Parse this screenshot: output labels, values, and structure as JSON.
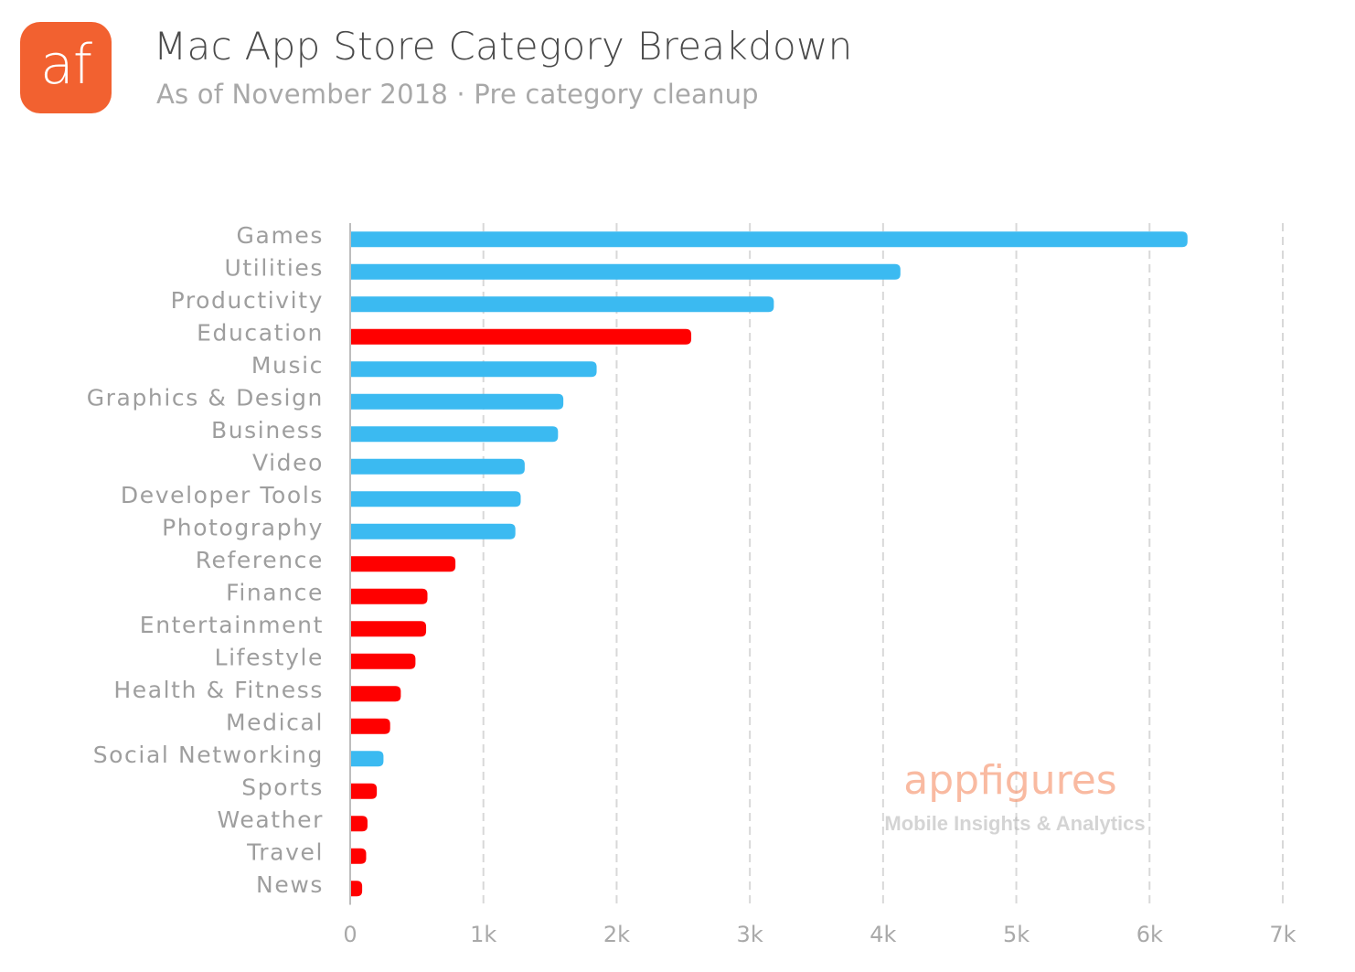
{
  "header": {
    "logo_text": "af",
    "title": "Mac App Store Category Breakdown",
    "subtitle": "As of November 2018 · Pre category cleanup"
  },
  "colors": {
    "logo": "#f26130",
    "highlight_bar": "#3bbaf1",
    "other_bar": "#ff0000",
    "watermark_brand": "#f7a07e"
  },
  "watermark": {
    "brand": "appfigures",
    "tagline": "Mobile Insights & Analytics"
  },
  "chart_data": {
    "type": "bar",
    "orientation": "horizontal",
    "title": "Mac App Store Category Breakdown",
    "subtitle": "As of November 2018 · Pre category cleanup",
    "xlabel": "",
    "ylabel": "",
    "xlim": [
      0,
      7000
    ],
    "x_ticks": [
      0,
      1000,
      2000,
      3000,
      4000,
      5000,
      6000,
      7000
    ],
    "x_tick_labels": [
      "0",
      "1k",
      "2k",
      "3k",
      "4k",
      "5k",
      "6k",
      "7k"
    ],
    "grid": "vertical dashed",
    "legend": "none",
    "categories": [
      "Games",
      "Utilities",
      "Productivity",
      "Education",
      "Music",
      "Graphics & Design",
      "Business",
      "Video",
      "Developer Tools",
      "Photography",
      "Reference",
      "Finance",
      "Entertainment",
      "Lifestyle",
      "Health & Fitness",
      "Medical",
      "Social Networking",
      "Sports",
      "Weather",
      "Travel",
      "News"
    ],
    "values": [
      6285,
      4130,
      3180,
      2560,
      1850,
      1600,
      1560,
      1310,
      1280,
      1240,
      790,
      580,
      570,
      490,
      380,
      300,
      250,
      200,
      130,
      120,
      90
    ],
    "bar_colors": [
      "blue",
      "blue",
      "blue",
      "red",
      "blue",
      "blue",
      "blue",
      "blue",
      "blue",
      "blue",
      "red",
      "red",
      "red",
      "red",
      "red",
      "red",
      "blue",
      "red",
      "red",
      "red",
      "red"
    ]
  }
}
